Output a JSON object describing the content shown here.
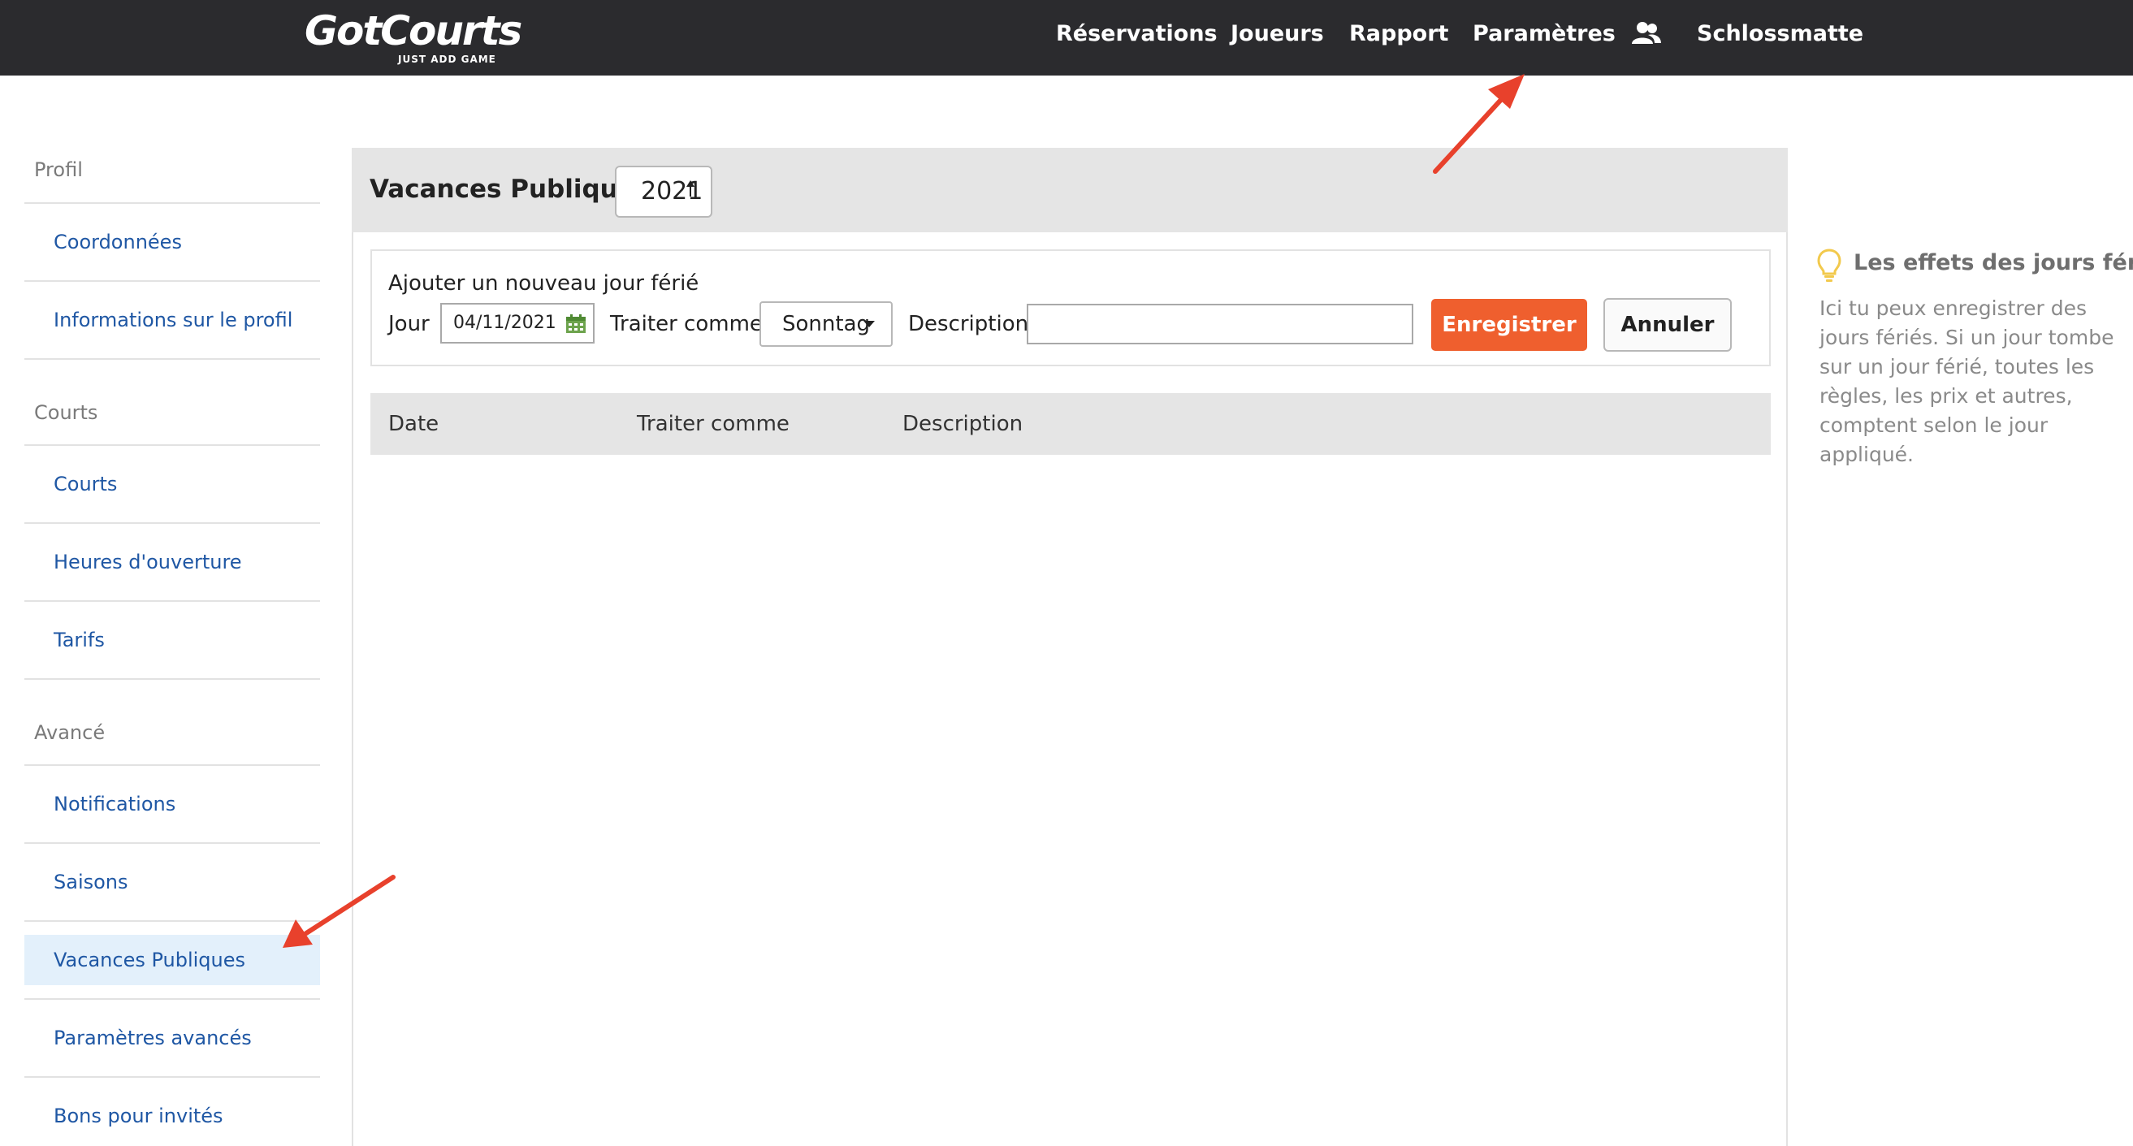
{
  "app": {
    "logo_text": "GotCourts",
    "logo_tagline": "JUST ADD GAME"
  },
  "nav": {
    "items": [
      {
        "label": "Réservations"
      },
      {
        "label": "Joueurs"
      },
      {
        "label": "Rapport"
      },
      {
        "label": "Paramètres"
      }
    ],
    "users_icon": "users-icon",
    "club_name": "Schlossmatte"
  },
  "sidebar": {
    "groups": [
      {
        "title": "Profil",
        "items": [
          {
            "label": "Coordonnées"
          },
          {
            "label": "Informations sur le profil"
          }
        ]
      },
      {
        "title": "Courts",
        "items": [
          {
            "label": "Courts"
          },
          {
            "label": "Heures d'ouverture"
          },
          {
            "label": "Tarifs"
          }
        ]
      },
      {
        "title": "Avancé",
        "items": [
          {
            "label": "Notifications"
          },
          {
            "label": "Saisons"
          },
          {
            "label": "Vacances Publiques",
            "active": true
          },
          {
            "label": "Paramètres avancés"
          },
          {
            "label": "Bons pour invités"
          }
        ]
      }
    ]
  },
  "main": {
    "title": "Vacances Publiques",
    "year": "2021",
    "form": {
      "heading": "Ajouter un nouveau jour férié",
      "day_label": "Jour",
      "day_value": "04/11/2021",
      "treat_label": "Traiter comme",
      "treat_value": "Sonntag",
      "description_label": "Description",
      "description_value": "",
      "save_label": "Enregistrer",
      "cancel_label": "Annuler"
    },
    "table": {
      "columns": [
        "Date",
        "Traiter comme",
        "Description"
      ],
      "rows": []
    }
  },
  "info": {
    "icon": "lightbulb-icon",
    "title": "Les effets des jours férié",
    "text": "Ici tu peux enregistrer des jours fériés. Si un jour tombe sur un jour férié, toutes les règles, les prix et autres, comptent selon le jour appliqué."
  },
  "colors": {
    "topbar": "#2b2b2e",
    "link": "#1f57a4",
    "accent": "#ef5f2e",
    "active_bg": "#e3f0fb",
    "annotation": "#e8412c"
  }
}
